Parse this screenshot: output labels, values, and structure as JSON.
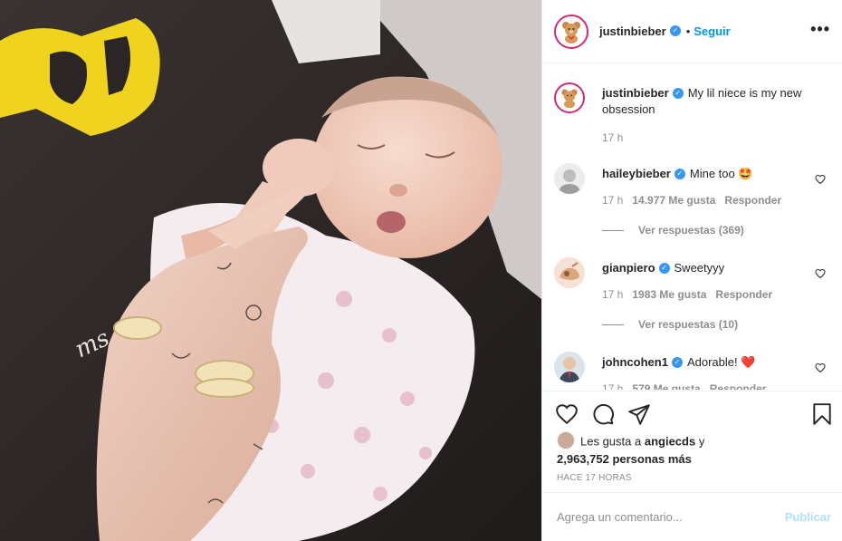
{
  "post": {
    "author": "justinbieber",
    "follow_label": "Seguir",
    "separator": "•",
    "more_label": "•••",
    "caption": "My lil niece is my new obsession",
    "caption_time": "17 h"
  },
  "comments": [
    {
      "username": "haileybieber",
      "text": "Mine too 🤩",
      "time": "17 h",
      "likes": "14.977 Me gusta",
      "reply": "Responder",
      "view_replies": "Ver respuestas (369)"
    },
    {
      "username": "gianpiero",
      "text": "Sweetyyy",
      "time": "17 h",
      "likes": "1983 Me gusta",
      "reply": "Responder",
      "view_replies": "Ver respuestas (10)"
    },
    {
      "username": "johncohen1",
      "text": "Adorable! ❤️",
      "time": "17 h",
      "likes": "579 Me gusta",
      "reply": "Responder"
    }
  ],
  "likes_summary": {
    "prefix": "Les gusta a",
    "user": "angiecds",
    "conj": "y",
    "others": "2,963,752 personas más"
  },
  "timestamp": "HACE 17 HORAS",
  "comment_box": {
    "placeholder": "Agrega un comentario...",
    "publish_label": "Publicar"
  },
  "colors": {
    "accent": "#0095f6",
    "verified": "#3897f0",
    "publish_disabled": "#b2dffc",
    "heart_red": "#ed4956"
  }
}
